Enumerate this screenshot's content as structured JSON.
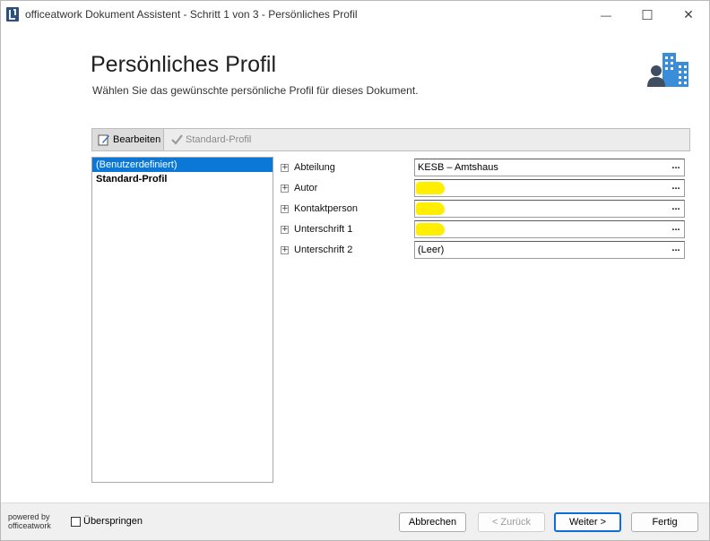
{
  "window": {
    "title": "officeatwork Dokument Assistent - Schritt 1 von 3 - Persönliches Profil",
    "minimize": "—",
    "maximize": "☐",
    "close": "✕"
  },
  "header": {
    "title": "Persönliches Profil",
    "subtitle": "Wählen Sie das gewünschte persönliche Profil für dieses Dokument.",
    "graphic_icon": "user-building-icon"
  },
  "toolbar": {
    "edit_label": "Bearbeiten",
    "standard_label": "Standard-Profil"
  },
  "profiles": [
    {
      "label": "(Benutzerdefiniert)",
      "selected": true
    },
    {
      "label": "Standard-Profil",
      "selected": false
    }
  ],
  "properties": [
    {
      "label": "Abteilung",
      "value": "KESB – Amtshaus",
      "expand": "+",
      "button": "...",
      "redacted": false
    },
    {
      "label": "Autor",
      "value": "",
      "expand": "+",
      "button": "...",
      "redacted": true
    },
    {
      "label": "Kontaktperson",
      "value": "",
      "expand": "+",
      "button": "...",
      "redacted": true
    },
    {
      "label": "Unterschrift 1",
      "value": "",
      "expand": "+",
      "button": "...",
      "redacted": true
    },
    {
      "label": "Unterschrift 2",
      "value": "(Leer)",
      "expand": "+",
      "button": "...",
      "redacted": false
    }
  ],
  "footer": {
    "powered_line1": "powered by",
    "powered_line2": "officeatwork",
    "skip_label": "Überspringen",
    "cancel": "Abbrechen",
    "back": "< Zurück",
    "next": "Weiter >",
    "finish": "Fertig"
  },
  "colors": {
    "selection": "#0b78d7",
    "highlight": "#ffee00",
    "default_button_border": "#0b6fd6"
  }
}
